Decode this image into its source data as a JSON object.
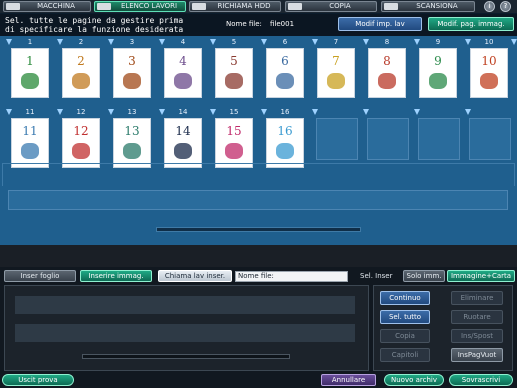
{
  "top_tabs": [
    {
      "label": "MACCHINA",
      "icon": "machine-icon",
      "active": false
    },
    {
      "label": "ELENCO LAVORI",
      "icon": "job-list-icon",
      "active": true
    },
    {
      "label": "RICHIAMA HDD",
      "icon": "hdd-icon",
      "active": false
    },
    {
      "label": "COPIA",
      "icon": "copy-icon",
      "active": false
    },
    {
      "label": "SCANSIONA",
      "icon": "scan-icon",
      "active": false
    }
  ],
  "top_icons": {
    "info": "i",
    "help": "?"
  },
  "header": {
    "instruction_line1": "Sel. tutte le pagine da gestire prima",
    "instruction_line2": " di specificare la funzione desiderata",
    "file_name_label": "Nome file:",
    "file_name": "file001",
    "btn_job_settings": "Modif imp. lav",
    "btn_image_edit": "Modif. pag. immag."
  },
  "pages": [
    {
      "number": "1",
      "color": "#2a8a3a"
    },
    {
      "number": "2",
      "color": "#c07a20"
    },
    {
      "number": "3",
      "color": "#a04a18"
    },
    {
      "number": "4",
      "color": "#6a4a8a"
    },
    {
      "number": "5",
      "color": "#8a3a30"
    },
    {
      "number": "6",
      "color": "#3a6aa0"
    },
    {
      "number": "7",
      "color": "#c8a020"
    },
    {
      "number": "8",
      "color": "#b83a2a"
    },
    {
      "number": "9",
      "color": "#2a8a4a"
    },
    {
      "number": "10",
      "color": "#c04020"
    },
    {
      "number": "11",
      "color": "#3a7ab0"
    },
    {
      "number": "12",
      "color": "#c03030"
    },
    {
      "number": "13",
      "color": "#2a7a6a"
    },
    {
      "number": "14",
      "color": "#1a2a4a"
    },
    {
      "number": "15",
      "color": "#c02a6a"
    },
    {
      "number": "16",
      "color": "#3a9ad0"
    }
  ],
  "lower_bar": {
    "insert_sheet": "Inser foglio",
    "insert_image": "Inserire immag.",
    "recall_job": "Chiama lav inser.",
    "file_name_label": "Nome file:",
    "file_name_value": "",
    "sel_insert": "Sel. Inser",
    "only_image": "Solo imm.",
    "image_paper": "Immagine+Carta"
  },
  "functions": {
    "continue": "Continuo",
    "select_all": "Sel. tutto",
    "copy": "Copia",
    "chapters": "Capitoli",
    "delete": "Eliminare",
    "rotate": "Ruotare",
    "ins_move": "Ins/Spost",
    "ins_blank": "InsPagVuot"
  },
  "footer": {
    "exit_proof": "Uscit prova",
    "cancel": "Annullare",
    "new_archive": "Nuovo archiv",
    "overwrite": "Sovrascrivi"
  },
  "colors": {
    "accent_active": "#1f8a6a",
    "panel_bg": "#1f5f8e",
    "selected_blue": "#3c6ca8"
  }
}
